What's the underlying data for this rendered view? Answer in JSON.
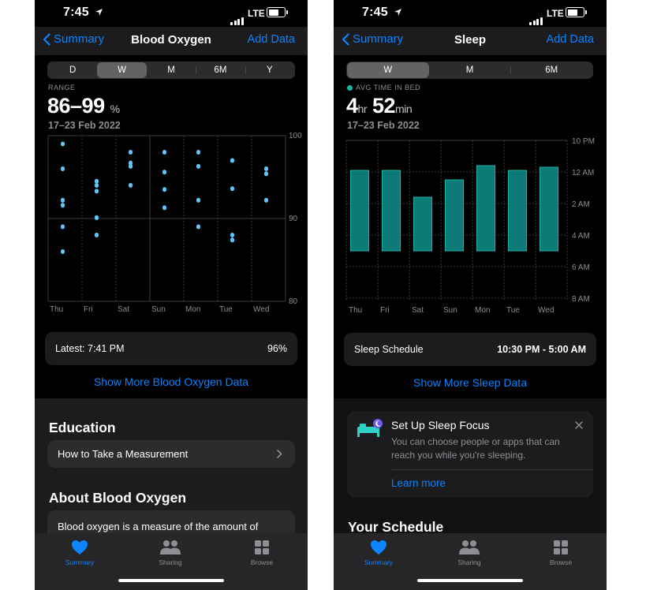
{
  "status": {
    "time": "7:45",
    "network": "LTE"
  },
  "left": {
    "nav": {
      "back": "Summary",
      "title": "Blood Oxygen",
      "add": "Add Data"
    },
    "segments": [
      "D",
      "W",
      "M",
      "6M",
      "Y"
    ],
    "selected_segment": "W",
    "metric_label": "RANGE",
    "metric_value": "86–99",
    "metric_unit": "%",
    "date_range": "17–23 Feb 2022",
    "latest_label": "Latest: 7:41 PM",
    "latest_value": "96%",
    "show_more": "Show More Blood Oxygen Data",
    "education_heading": "Education",
    "education_item": "How to Take a Measurement",
    "about_heading": "About Blood Oxygen",
    "about_text": "Blood oxygen is a measure of the amount of"
  },
  "right": {
    "nav": {
      "back": "Summary",
      "title": "Sleep",
      "add": "Add Data"
    },
    "segments": [
      "W",
      "M",
      "6M"
    ],
    "selected_segment": "W",
    "metric_label": "AVG TIME IN BED",
    "metric_hours": "4",
    "metric_hr_unit": "hr",
    "metric_minutes": "52",
    "metric_min_unit": "min",
    "date_range": "17–23 Feb 2022",
    "schedule_label": "Sleep Schedule",
    "schedule_value": "10:30 PM - 5:00 AM",
    "show_more": "Show More Sleep Data",
    "focus": {
      "title": "Set Up Sleep Focus",
      "body_line1": "You can choose people or apps that can",
      "body_line2": "reach you while you're sleeping.",
      "link": "Learn more"
    },
    "your_schedule_heading": "Your Schedule"
  },
  "tabs": [
    {
      "label": "Summary",
      "icon": "heart-icon",
      "active": true
    },
    {
      "label": "Sharing",
      "icon": "people-icon",
      "active": false
    },
    {
      "label": "Browse",
      "icon": "grid-icon",
      "active": false
    }
  ],
  "colors": {
    "accent": "#0a84ff",
    "oxygen_point": "#5ac8fa",
    "sleep_bar": "#0e7a76",
    "sleep_bar_edge": "#18b3a8"
  },
  "chart_data": [
    {
      "type": "scatter",
      "categories": [
        "Thu",
        "Fri",
        "Sat",
        "Sun",
        "Mon",
        "Tue",
        "Wed"
      ],
      "ylim": [
        80,
        100
      ],
      "y_ticks": [
        "100",
        "90",
        "80"
      ],
      "series": [
        {
          "values": [
            [
              99,
              96,
              92.2,
              91.6,
              89,
              86
            ],
            [
              94.5,
              94,
              93.3,
              90.1,
              88
            ],
            [
              98,
              96.7,
              96.3,
              94
            ],
            [
              98,
              95.6,
              93.5,
              91.3
            ],
            [
              98,
              96.3,
              92.2,
              89
            ],
            [
              97,
              93.6,
              88,
              87.4
            ],
            [
              96,
              95.4,
              92.2
            ]
          ]
        }
      ]
    },
    {
      "type": "bar",
      "categories": [
        "Thu",
        "Fri",
        "Sat",
        "Sun",
        "Mon",
        "Tue",
        "Wed"
      ],
      "y_ticks": [
        "10 PM",
        "12 AM",
        "2 AM",
        "4 AM",
        "6 AM",
        "8 AM"
      ],
      "ylim_hours_after_10pm": [
        0,
        10
      ],
      "series": [
        {
          "values": [
            [
              1.9,
              7.0
            ],
            [
              1.9,
              7.0
            ],
            [
              3.6,
              7.0
            ],
            [
              2.5,
              7.0
            ],
            [
              1.6,
              7.0
            ],
            [
              1.9,
              7.0
            ],
            [
              1.7,
              7.0
            ]
          ]
        }
      ]
    }
  ]
}
